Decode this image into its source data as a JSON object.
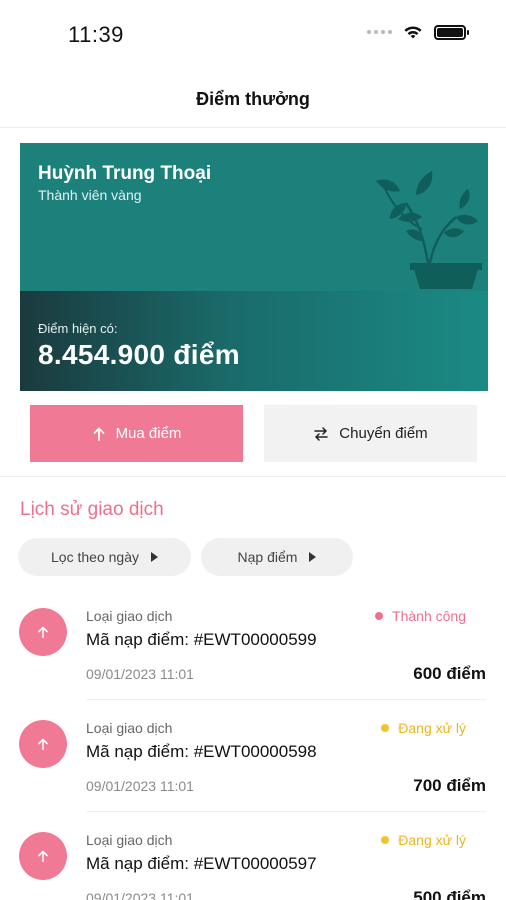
{
  "status_bar": {
    "time": "11:39"
  },
  "header": {
    "title": "Điểm thưởng"
  },
  "card": {
    "name": "Huỳnh Trung Thoại",
    "tier": "Thành viên vàng",
    "points_label": "Điểm hiện có:",
    "points_value": "8.454.900 điểm",
    "colors": {
      "top": "#1c807b",
      "bottom_dark": "#1a3a3e"
    }
  },
  "actions": {
    "buy_label": "Mua điểm",
    "buy_icon": "arrow-up-icon",
    "transfer_label": "Chuyển điểm",
    "transfer_icon": "swap-arrows-icon",
    "accent_color": "#f07a95"
  },
  "history": {
    "title": "Lịch sử giao dịch",
    "filters": {
      "date": "Lọc theo ngày",
      "type": "Nạp điểm"
    }
  },
  "transactions": [
    {
      "type_label": "Loại giao dịch",
      "code": "Mã nạp điểm: #EWT00000599",
      "status": "Thành công",
      "status_color": "#ef6f8d",
      "dot_color": "#ef6f8d",
      "date": "09/01/2023 11:01",
      "amount": "600 điểm"
    },
    {
      "type_label": "Loại giao dịch",
      "code": "Mã nạp điểm: #EWT00000598",
      "status": "Đang xử lý",
      "status_color": "#e9b51f",
      "dot_color": "#f2c12e",
      "date": "09/01/2023 11:01",
      "amount": "700 điểm"
    },
    {
      "type_label": "Loại giao dịch",
      "code": "Mã nạp điểm: #EWT00000597",
      "status": "Đang xử lý",
      "status_color": "#e9b51f",
      "dot_color": "#f2c12e",
      "date": "09/01/2023 11:01",
      "amount": "500 điểm"
    }
  ]
}
